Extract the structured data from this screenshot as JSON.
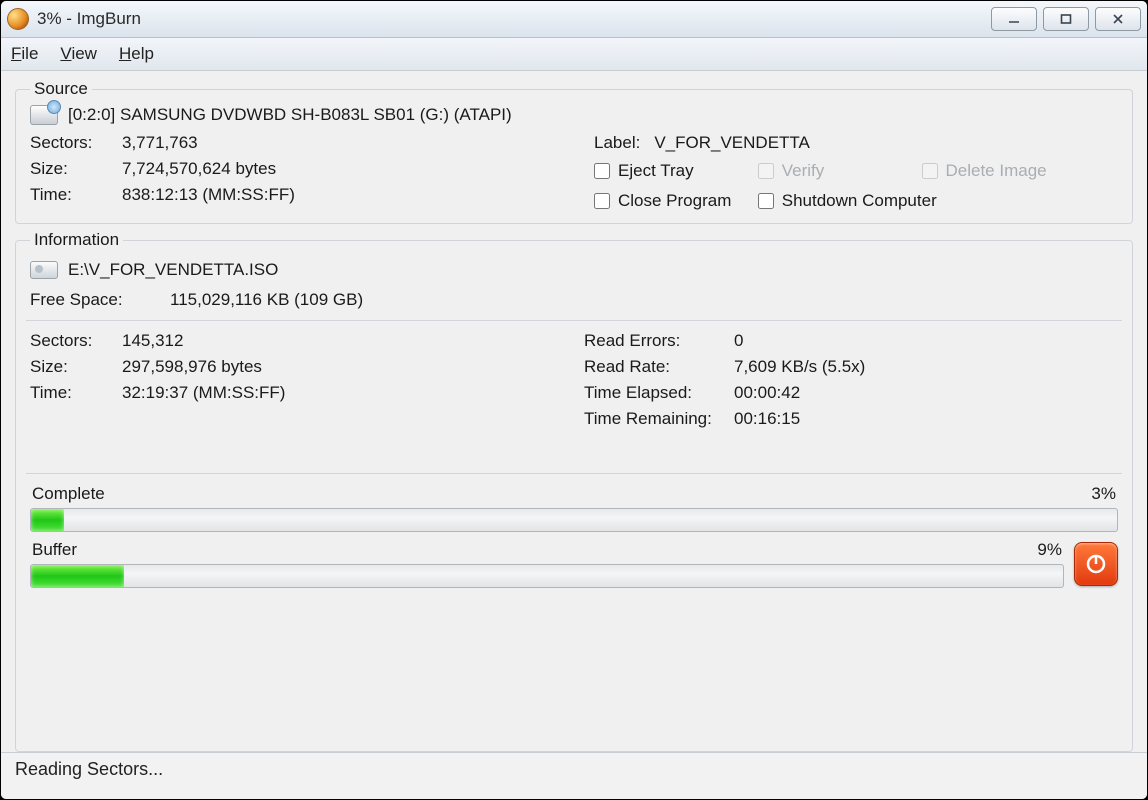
{
  "window": {
    "title": "3% - ImgBurn"
  },
  "menu": {
    "file": "File",
    "view": "View",
    "help": "Help"
  },
  "source": {
    "legend": "Source",
    "device": "[0:2:0] SAMSUNG DVDWBD SH-B083L SB01 (G:) (ATAPI)",
    "sectors_label": "Sectors:",
    "sectors": "3,771,763",
    "size_label": "Size:",
    "size": "7,724,570,624 bytes",
    "time_label": "Time:",
    "time": "838:12:13 (MM:SS:FF)",
    "label_label": "Label:",
    "label_value": "V_FOR_VENDETTA",
    "eject": "Eject Tray",
    "verify": "Verify",
    "delete_image": "Delete Image",
    "close_program": "Close Program",
    "shutdown": "Shutdown Computer"
  },
  "info": {
    "legend": "Information",
    "path": "E:\\V_FOR_VENDETTA.ISO",
    "freespace_label": "Free Space:",
    "freespace": "115,029,116 KB  (109 GB)",
    "sectors_label": "Sectors:",
    "sectors": "145,312",
    "size_label": "Size:",
    "size": "297,598,976 bytes",
    "time_label": "Time:",
    "time": "32:19:37 (MM:SS:FF)",
    "read_errors_label": "Read Errors:",
    "read_errors": "0",
    "read_rate_label": "Read Rate:",
    "read_rate": "7,609 KB/s (5.5x)",
    "elapsed_label": "Time Elapsed:",
    "elapsed": "00:00:42",
    "remaining_label": "Time Remaining:",
    "remaining": "00:16:15"
  },
  "progress": {
    "complete_label": "Complete",
    "complete_pct": "3%",
    "complete_width": "3%",
    "buffer_label": "Buffer",
    "buffer_pct": "9%",
    "buffer_width": "9%"
  },
  "status": "Reading Sectors..."
}
